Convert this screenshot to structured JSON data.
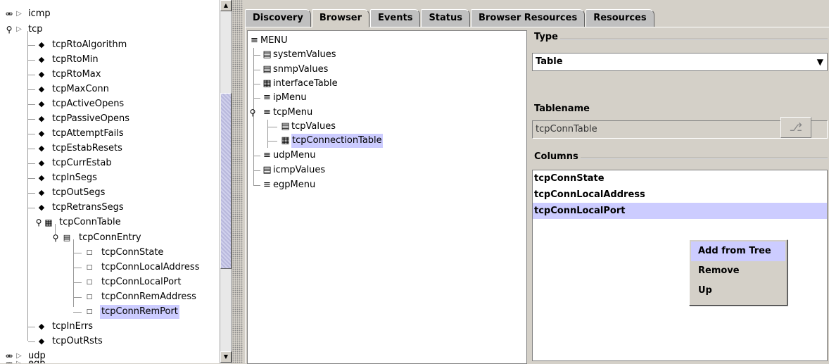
{
  "mib_tree": {
    "nodes": [
      {
        "label": "icmp",
        "kind": "folder",
        "expanded": false
      },
      {
        "label": "tcp",
        "kind": "folder",
        "expanded": true
      },
      {
        "label": "tcpRtoAlgorithm",
        "kind": "scalar"
      },
      {
        "label": "tcpRtoMin",
        "kind": "scalar"
      },
      {
        "label": "tcpRtoMax",
        "kind": "scalar"
      },
      {
        "label": "tcpMaxConn",
        "kind": "scalar"
      },
      {
        "label": "tcpActiveOpens",
        "kind": "scalar"
      },
      {
        "label": "tcpPassiveOpens",
        "kind": "scalar"
      },
      {
        "label": "tcpAttemptFails",
        "kind": "scalar"
      },
      {
        "label": "tcpEstabResets",
        "kind": "scalar"
      },
      {
        "label": "tcpCurrEstab",
        "kind": "scalar"
      },
      {
        "label": "tcpInSegs",
        "kind": "scalar"
      },
      {
        "label": "tcpOutSegs",
        "kind": "scalar"
      },
      {
        "label": "tcpRetransSegs",
        "kind": "scalar"
      },
      {
        "label": "tcpConnTable",
        "kind": "table",
        "expanded": true
      },
      {
        "label": "tcpConnEntry",
        "kind": "entry",
        "expanded": true
      },
      {
        "label": "tcpConnState",
        "kind": "column"
      },
      {
        "label": "tcpConnLocalAddress",
        "kind": "column"
      },
      {
        "label": "tcpConnLocalPort",
        "kind": "column"
      },
      {
        "label": "tcpConnRemAddress",
        "kind": "column"
      },
      {
        "label": "tcpConnRemPort",
        "kind": "column",
        "selected": true
      },
      {
        "label": "tcpInErrs",
        "kind": "scalar"
      },
      {
        "label": "tcpOutRsts",
        "kind": "scalar"
      },
      {
        "label": "udp",
        "kind": "folder",
        "expanded": false
      },
      {
        "label": "egp",
        "kind": "folder",
        "expanded": false
      }
    ]
  },
  "tabs": [
    {
      "label": "Discovery",
      "active": false
    },
    {
      "label": "Browser",
      "active": true
    },
    {
      "label": "Events",
      "active": false
    },
    {
      "label": "Status",
      "active": false
    },
    {
      "label": "Browser Resources",
      "active": false
    },
    {
      "label": "Resources",
      "active": false
    }
  ],
  "menu_tree": {
    "root": "MENU",
    "items": [
      {
        "label": "systemValues",
        "icon": "values-icon"
      },
      {
        "label": "snmpValues",
        "icon": "values-icon"
      },
      {
        "label": "interfaceTable",
        "icon": "table-icon"
      },
      {
        "label": "ipMenu",
        "icon": "menu-icon"
      },
      {
        "label": "tcpMenu",
        "icon": "menu-icon"
      },
      {
        "label": "tcpValues",
        "icon": "values-icon"
      },
      {
        "label": "tcpConnectionTable",
        "icon": "table-icon",
        "selected": true
      },
      {
        "label": "udpMenu",
        "icon": "menu-icon"
      },
      {
        "label": "icmpValues",
        "icon": "values-icon"
      },
      {
        "label": "egpMenu",
        "icon": "menu-icon"
      }
    ]
  },
  "form": {
    "type_title": "Type",
    "type_value": "Table",
    "tablename_label": "Tablename",
    "tablename_value": "tcpConnTable",
    "columns_title": "Columns",
    "columns": [
      {
        "label": "tcpConnState",
        "selected": false
      },
      {
        "label": "tcpConnLocalAddress",
        "selected": false
      },
      {
        "label": "tcpConnLocalPort",
        "selected": true
      }
    ]
  },
  "context_menu": {
    "items": [
      {
        "label": "Add from Tree",
        "highlighted": true
      },
      {
        "label": "Remove",
        "highlighted": false
      },
      {
        "label": "Up",
        "highlighted": false
      }
    ]
  },
  "colors": {
    "selection": "#ccccff",
    "panel_bg": "#d4d0c8"
  }
}
